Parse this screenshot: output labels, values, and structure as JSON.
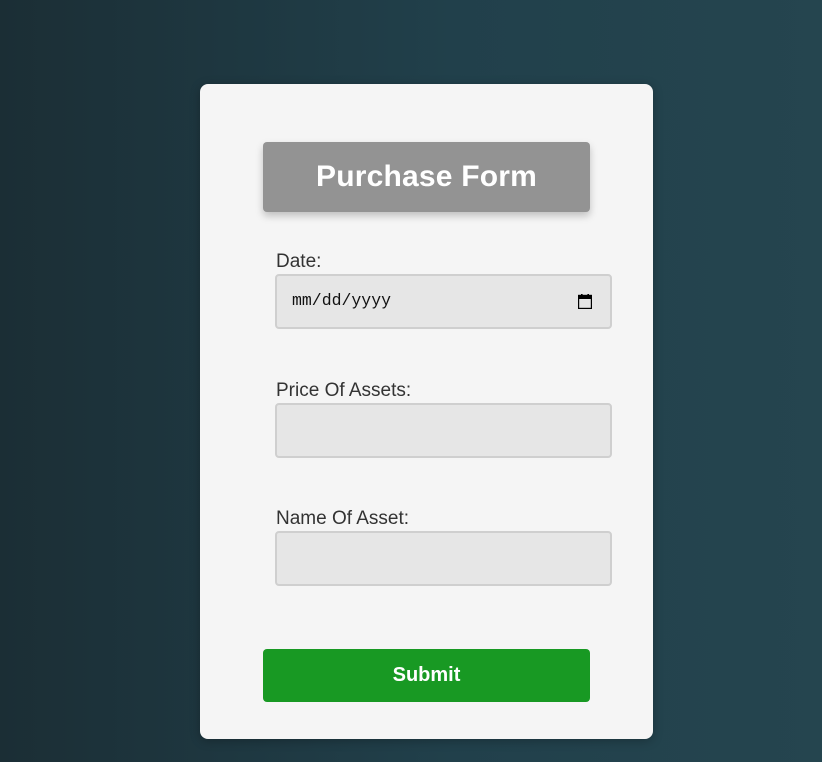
{
  "form": {
    "title": "Purchase Form",
    "fields": [
      {
        "label": "Date:",
        "value": "mm/dd/yyyy",
        "icon": "calendar-icon"
      },
      {
        "label": "Price Of Assets:",
        "value": ""
      },
      {
        "label": "Name Of Asset:",
        "value": ""
      }
    ],
    "submit_label": "Submit"
  },
  "colors": {
    "background_left": "#1b2e35",
    "background_right": "#25454f",
    "card": "#f5f5f5",
    "title_box": "#939393",
    "input_fill": "#e6e6e6",
    "input_border": "#cfcfcf",
    "submit": "#189923"
  }
}
